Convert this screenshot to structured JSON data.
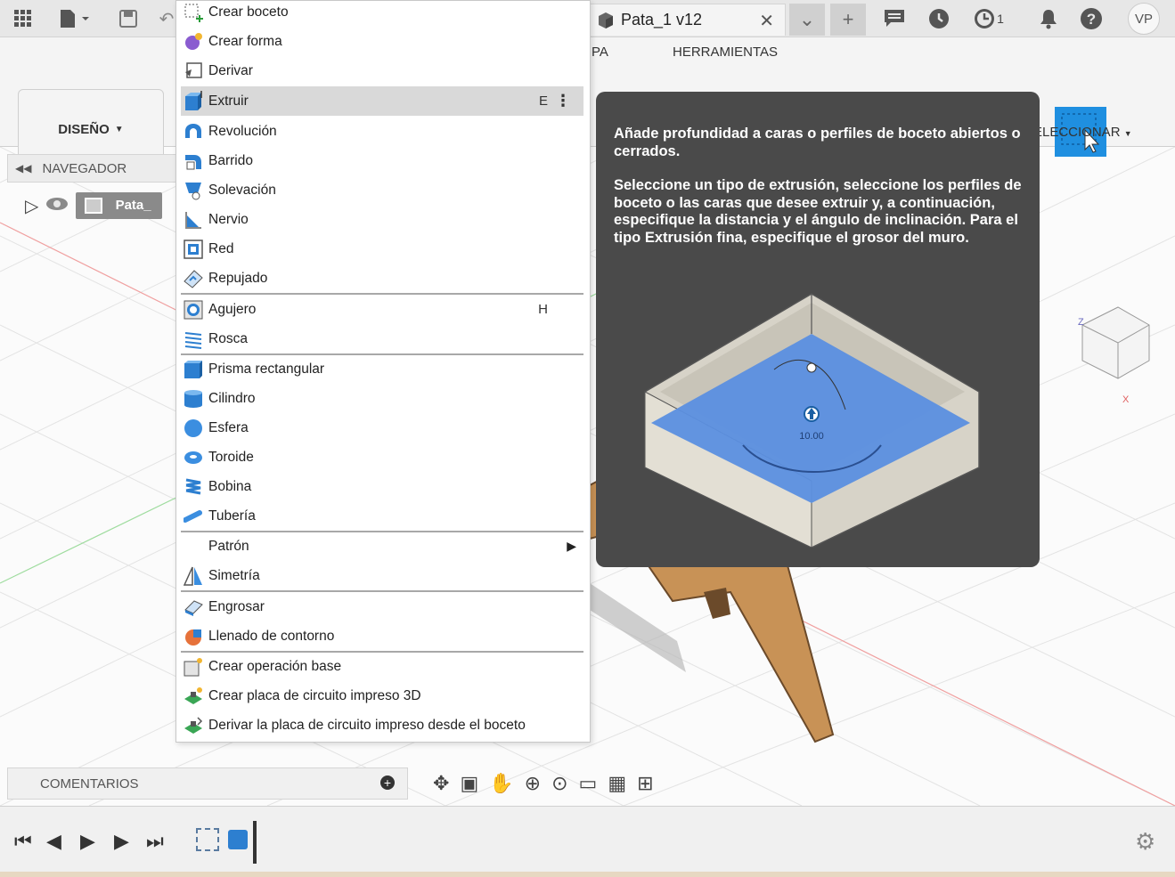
{
  "window": {
    "doc_tab": "Pata_1 v12",
    "avatar": "VP",
    "jobs_count": "1",
    "ribbon": {
      "design": "DISEÑO",
      "tab_partial": "PA",
      "tools": "HERRAMIENTAS",
      "select": "ELECCIONAR"
    }
  },
  "navigator": {
    "title": "NAVEGADOR",
    "component": "Pata_"
  },
  "menu": {
    "items": [
      {
        "label": "Crear boceto",
        "icon": "create-sketch-icon"
      },
      {
        "label": "Crear forma",
        "icon": "create-form-icon"
      },
      {
        "label": "Derivar",
        "icon": "derive-icon"
      },
      {
        "label": "Extruir",
        "icon": "extrude-icon",
        "shortcut": "E",
        "highlighted": true
      },
      {
        "label": "Revolución",
        "icon": "revolve-icon"
      },
      {
        "label": "Barrido",
        "icon": "sweep-icon"
      },
      {
        "label": "Solevación",
        "icon": "loft-icon"
      },
      {
        "label": "Nervio",
        "icon": "rib-icon"
      },
      {
        "label": "Red",
        "icon": "web-icon"
      },
      {
        "label": "Repujado",
        "icon": "emboss-icon"
      },
      {
        "label": "Agujero",
        "icon": "hole-icon",
        "shortcut": "H"
      },
      {
        "label": "Rosca",
        "icon": "thread-icon"
      },
      {
        "label": "Prisma rectangular",
        "icon": "box-icon"
      },
      {
        "label": "Cilindro",
        "icon": "cylinder-icon"
      },
      {
        "label": "Esfera",
        "icon": "sphere-icon"
      },
      {
        "label": "Toroide",
        "icon": "torus-icon"
      },
      {
        "label": "Bobina",
        "icon": "coil-icon"
      },
      {
        "label": "Tubería",
        "icon": "pipe-icon"
      },
      {
        "label": "Patrón",
        "icon": "",
        "submenu": true
      },
      {
        "label": "Simetría",
        "icon": "mirror-icon"
      },
      {
        "label": "Engrosar",
        "icon": "thicken-icon"
      },
      {
        "label": "Llenado de contorno",
        "icon": "boundary-fill-icon"
      },
      {
        "label": "Crear operación base",
        "icon": "base-feature-icon"
      },
      {
        "label": "Crear placa de circuito impreso 3D",
        "icon": "pcb-3d-icon"
      },
      {
        "label": "Derivar la placa de circuito impreso desde el boceto",
        "icon": "pcb-derive-icon"
      }
    ]
  },
  "tooltip": {
    "p1": "Añade profundidad a caras o perfiles de boceto abiertos o cerrados.",
    "p2": "Seleccione un tipo de extrusión, seleccione los perfiles de boceto o las caras que desee extruir y, a continuación, especifique la distancia y el ángulo de inclinación. Para el tipo Extrusión fina, especifique el grosor del muro.",
    "illustration_value": "10.00"
  },
  "comments": {
    "title": "COMENTARIOS"
  },
  "colors": {
    "accent": "#1f8fe0",
    "tooltip_bg": "#4a4a4a",
    "highlight": "#d9d9d9",
    "wood": "#c89256"
  }
}
